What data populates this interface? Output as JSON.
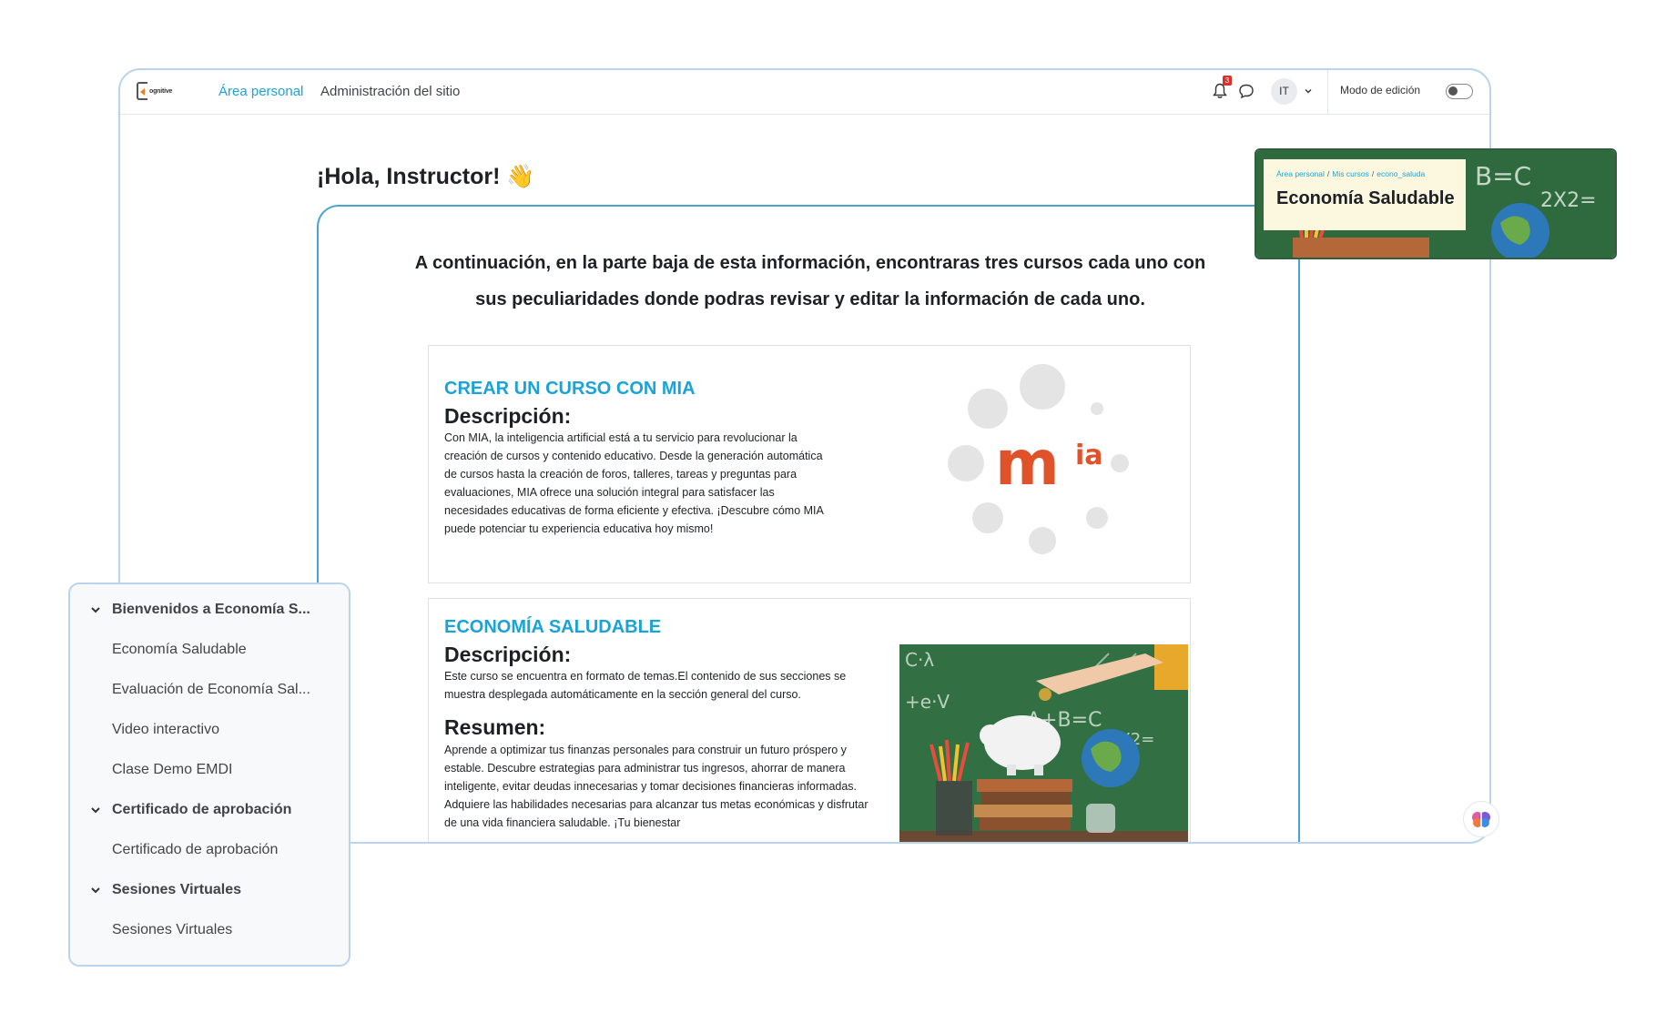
{
  "navbar": {
    "logo_text": "ognitive",
    "links": [
      "Área personal",
      "Administración del sitio"
    ],
    "notification_count": "3",
    "avatar_initials": "IT",
    "edit_mode_label": "Modo de edición",
    "edit_mode_on": false
  },
  "greeting": "¡Hola, Instructor! 👋",
  "intro_text": "A continuación, en la parte baja de esta información, encontraras tres cursos cada uno con sus peculiaridades donde podras revisar y editar la información de cada uno.",
  "courses": [
    {
      "title": "CREAR UN CURSO CON MIA",
      "description_heading": "Descripción:",
      "description": "Con MIA, la inteligencia artificial está a tu servicio para revolucionar la creación de cursos y contenido educativo. Desde la generación automática de cursos hasta la creación de foros, talleres, tareas y preguntas para evaluaciones, MIA ofrece una solución integral para satisfacer las necesidades educativas de forma eficiente y efectiva. ¡Descubre cómo MIA puede potenciar tu experiencia educativa hoy mismo!",
      "logo_text": "m",
      "logo_sup": "ia"
    },
    {
      "title": "ECONOMÍA SALUDABLE",
      "description_heading": "Descripción:",
      "description": "Este curso se encuentra en formato de temas.El contenido de sus secciones se muestra desplegada automáticamente en la sección general del curso.",
      "summary_heading": "Resumen:",
      "summary": "Aprende a optimizar tus finanzas personales para construir un futuro próspero y estable. Descubre estrategias para administrar tus ingresos, ahorrar de manera inteligente, evitar deudas innecesarias y tomar decisiones financieras informadas. Adquiere las habilidades necesarias para alcanzar tus metas económicas y disfrutar de una vida financiera saludable. ¡Tu bienestar"
    }
  ],
  "overlay": {
    "breadcrumbs": [
      "Área personal",
      "Mis cursos",
      "econo_saluda"
    ],
    "title": "Economía Saludable"
  },
  "course_index": [
    {
      "type": "section",
      "label": "Bienvenidos a Economía S..."
    },
    {
      "type": "item",
      "label": "Economía Saludable"
    },
    {
      "type": "item",
      "label": "Evaluación de Economía Sal..."
    },
    {
      "type": "item",
      "label": "Video interactivo"
    },
    {
      "type": "item",
      "label": "Clase Demo EMDI"
    },
    {
      "type": "section",
      "label": "Certificado de aprobación"
    },
    {
      "type": "item",
      "label": "Certificado de aprobación"
    },
    {
      "type": "section",
      "label": "Sesiones Virtuales"
    },
    {
      "type": "item",
      "label": "Sesiones Virtuales"
    }
  ],
  "colors": {
    "accent": "#1ba3d9",
    "mia_orange": "#e0532a",
    "badge_red": "#d9302c",
    "chalkboard_green": "#2e6a3e"
  }
}
